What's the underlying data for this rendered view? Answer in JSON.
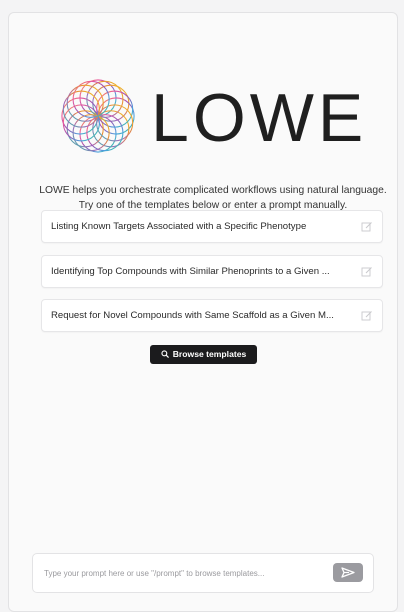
{
  "app": {
    "logo_text": "LOWE"
  },
  "intro": {
    "line1": "LOWE helps you orchestrate complicated workflows using natural language.",
    "line2": "Try one of the templates below or enter a prompt manually."
  },
  "templates": [
    {
      "label": "Listing Known Targets Associated with a Specific Phenotype",
      "icon": "edit-icon"
    },
    {
      "label": "Identifying Top Compounds with Similar Phenoprints to a Given ...",
      "icon": "edit-icon"
    },
    {
      "label": "Request for Novel Compounds with Same Scaffold as a Given M...",
      "icon": "edit-icon"
    }
  ],
  "browse": {
    "label": "Browse templates",
    "icon": "search-icon"
  },
  "prompt": {
    "placeholder": "Type your prompt here or use \"/prompt\" to browse templates...",
    "value": "",
    "send_icon": "send-icon"
  },
  "colors": {
    "button_dark": "#1b1b1d",
    "send_button": "#9b9ba0",
    "background": "#f4f4f5"
  }
}
